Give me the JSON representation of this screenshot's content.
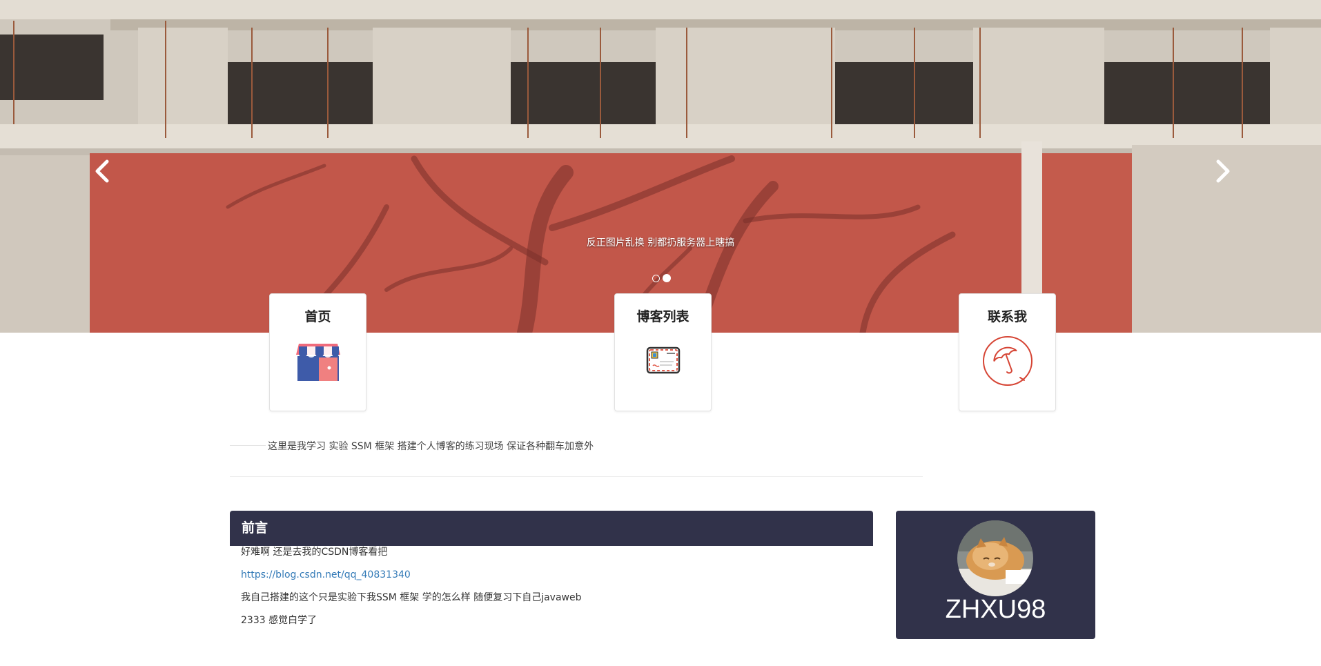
{
  "carousel": {
    "caption": "反正图片乱换 别都扔服务器上瞎搞",
    "slide_count": 2,
    "active_index": 1,
    "prev_label": "‹",
    "next_label": "›"
  },
  "nav": [
    {
      "title": "首页",
      "icon": "shop-icon"
    },
    {
      "title": "博客列表",
      "icon": "envelope-icon"
    },
    {
      "title": "联系我",
      "icon": "umbrella-icon"
    }
  ],
  "intro": {
    "text": "这里是我学习 实验 SSM 框架 搭建个人博客的练习现场 保证各种翻车加意外"
  },
  "preface": {
    "heading": "前言",
    "lines": [
      "好难啊 还是去我的CSDN博客看把",
      "https://blog.csdn.net/qq_40831340",
      "我自己搭建的这个只是实验下我SSM 框架 学的怎么样 随便复习下自己javaweb",
      "2333 感觉白学了"
    ]
  },
  "profile": {
    "username": "ZHXU98"
  },
  "colors": {
    "panel": "#31324a",
    "link": "#337ab7"
  }
}
